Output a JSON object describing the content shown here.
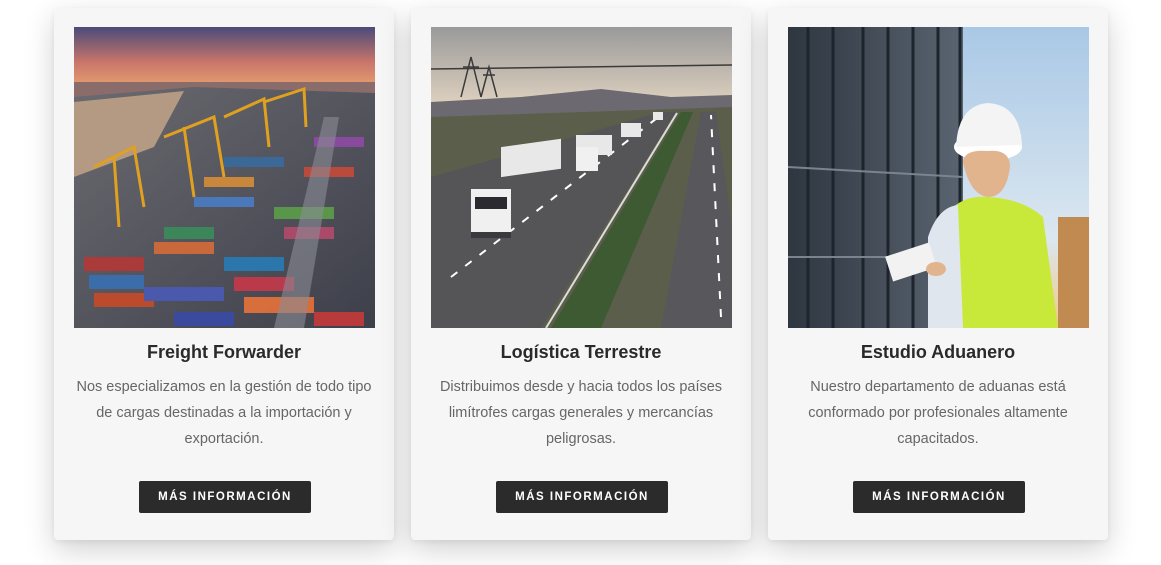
{
  "cards": [
    {
      "image_name": "port-containers-image",
      "title": "Freight Forwarder",
      "description": "Nos especializamos en la gestión de todo tipo de cargas destinadas a la importación y exportación.",
      "button_label": "MÁS INFORMACIÓN"
    },
    {
      "image_name": "highway-trucks-image",
      "title": "Logística Terrestre",
      "description": "Distribuimos desde y hacia todos los países limítrofes cargas generales y mercancías peligrosas.",
      "button_label": "MÁS INFORMACIÓN"
    },
    {
      "image_name": "customs-inspector-image",
      "title": "Estudio Aduanero",
      "description": "Nuestro departamento de aduanas está conformado por profesionales altamente capacitados.",
      "button_label": "MÁS INFORMACIÓN"
    }
  ],
  "colors": {
    "card_background": "#f6f6f6",
    "button_background": "#2b2b2b",
    "title_text": "#2a2a2a",
    "body_text": "#666666"
  }
}
